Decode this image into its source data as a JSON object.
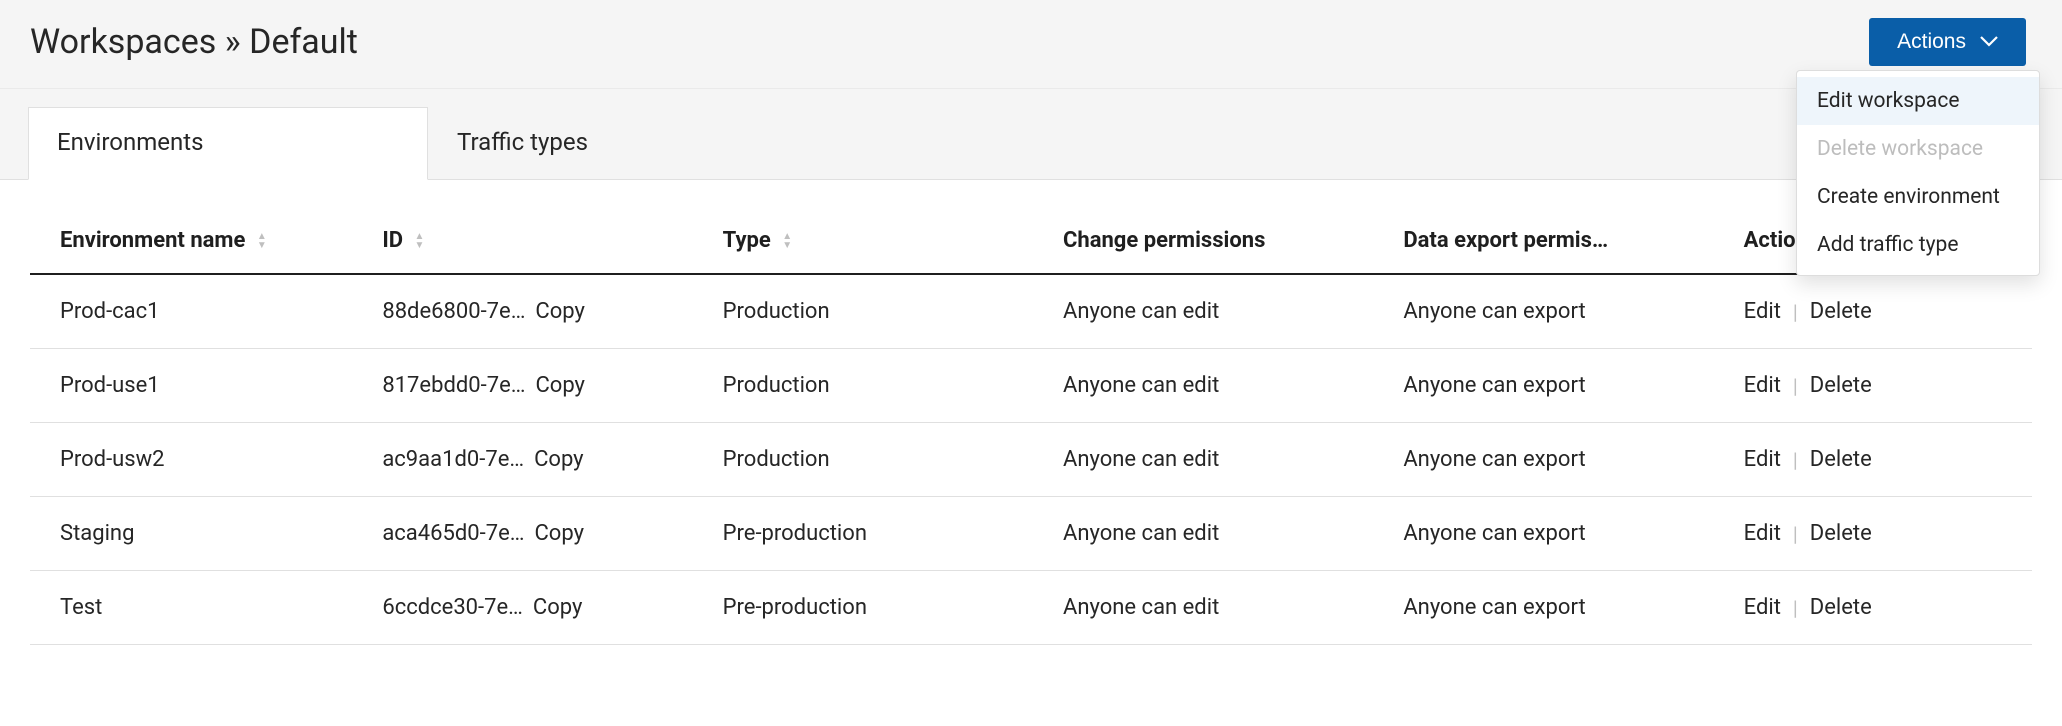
{
  "header": {
    "breadcrumb_root": "Workspaces",
    "breadcrumb_sep": " » ",
    "breadcrumb_leaf": "Default",
    "actions_button": "Actions"
  },
  "dropdown": {
    "items": [
      {
        "label": "Edit workspace",
        "state": "highlighted"
      },
      {
        "label": "Delete workspace",
        "state": "disabled"
      },
      {
        "label": "Create environment",
        "state": "normal"
      },
      {
        "label": "Add traffic type",
        "state": "normal"
      }
    ]
  },
  "tabs": [
    {
      "label": "Environments",
      "active": true
    },
    {
      "label": "Traffic types",
      "active": false
    }
  ],
  "table": {
    "columns": {
      "name": "Environment name",
      "id": "ID",
      "type": "Type",
      "change": "Change permissions",
      "export": "Data export permis…",
      "actions": "Actions"
    },
    "copy_label": "Copy",
    "edit_label": "Edit",
    "delete_label": "Delete",
    "rows": [
      {
        "name": "Prod-cac1",
        "id": "88de6800-7e…",
        "type": "Production",
        "change": "Anyone can edit",
        "export": "Anyone can export"
      },
      {
        "name": "Prod-use1",
        "id": "817ebdd0-7e…",
        "type": "Production",
        "change": "Anyone can edit",
        "export": "Anyone can export"
      },
      {
        "name": "Prod-usw2",
        "id": "ac9aa1d0-7e…",
        "type": "Production",
        "change": "Anyone can edit",
        "export": "Anyone can export"
      },
      {
        "name": "Staging",
        "id": "aca465d0-7e…",
        "type": "Pre-production",
        "change": "Anyone can edit",
        "export": "Anyone can export"
      },
      {
        "name": "Test",
        "id": "6ccdce30-7e…",
        "type": "Pre-production",
        "change": "Anyone can edit",
        "export": "Anyone can export"
      }
    ]
  }
}
